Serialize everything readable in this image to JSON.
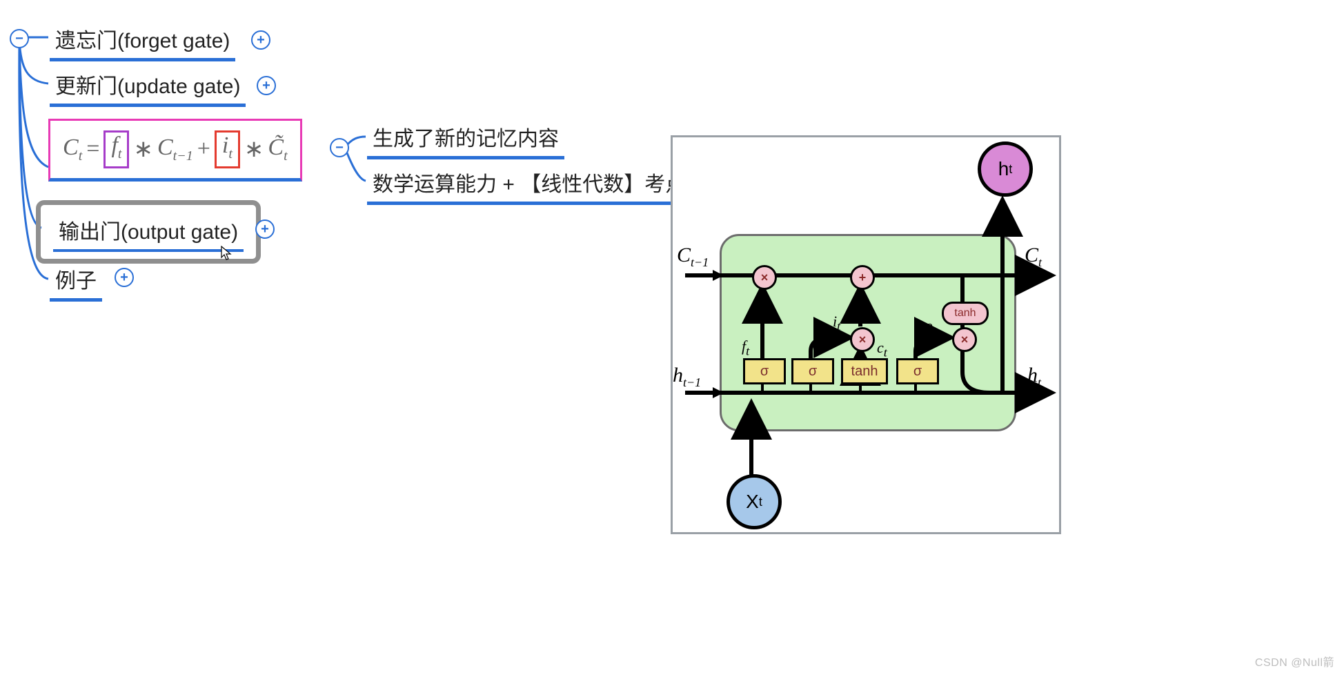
{
  "mindmap": {
    "root_toggle": "−",
    "nodes": {
      "forget": {
        "label": "遗忘门(forget gate)",
        "toggle": "+"
      },
      "update": {
        "label": "更新门(update gate)",
        "toggle": "+"
      },
      "formula": {
        "lhs": "C",
        "lhs_sub": "t",
        "eq": "=",
        "f": "f",
        "f_sub": "t",
        "times1": "∗",
        "c_prev": "C",
        "c_prev_sub": "t−1",
        "plus": "+",
        "i": "i",
        "i_sub": "t",
        "times2": "∗",
        "c_tilde": "C̃",
        "c_tilde_sub": "t",
        "toggle": "−",
        "children": {
          "child1": "生成了新的记忆内容",
          "child2": "数学运算能力 + 【线性代数】考点内"
        }
      },
      "output": {
        "label": "输出门(output gate)",
        "toggle": "+"
      },
      "example": {
        "label": "例子",
        "toggle": "+"
      }
    }
  },
  "lstm": {
    "inputs": {
      "c_prev": "C",
      "c_prev_sub": "t−1",
      "h_prev": "h",
      "h_prev_sub": "t−1",
      "x": "X",
      "x_sub": "t"
    },
    "outputs": {
      "c": "C",
      "c_sub": "t",
      "h": "h",
      "h_sub": "t",
      "h_top": "h",
      "h_top_sub": "t"
    },
    "gates": {
      "sigma": "σ",
      "tanh": "tanh",
      "f_label": "f",
      "f_sub": "t",
      "i_label": "i",
      "i_sub": "t",
      "c_label": "c",
      "c_sub": "t",
      "o_label": "o",
      "o_sub": "t"
    },
    "ops": {
      "mult": "×",
      "add": "+"
    }
  },
  "watermark": "CSDN @Null箭"
}
